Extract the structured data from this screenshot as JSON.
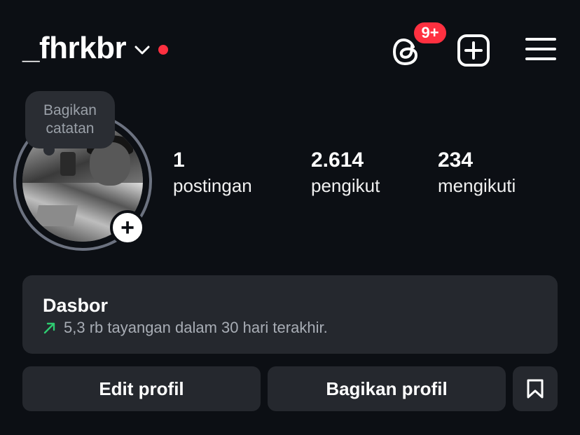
{
  "header": {
    "username": "_fhrkbr",
    "threads_badge": "9+"
  },
  "icons": {
    "threads": "threads-icon",
    "create": "plus-square-icon",
    "menu": "hamburger-menu-icon",
    "chevron": "chevron-down-icon",
    "trend": "arrow-up-right-icon",
    "saved": "bookmark-icon"
  },
  "colors": {
    "background": "#0c0f14",
    "notification": "#ff3040",
    "surface": "#25282e",
    "trend_green": "#2ecc71"
  },
  "profile": {
    "note_line1": "Bagikan",
    "note_line2": "catatan",
    "add_story": "+"
  },
  "stats": [
    {
      "value": "1",
      "label": "postingan"
    },
    {
      "value": "2.614",
      "label": "pengikut"
    },
    {
      "value": "234",
      "label": "mengikuti"
    }
  ],
  "dashboard": {
    "title": "Dasbor",
    "subtitle": "5,3 rb tayangan dalam 30 hari terakhir."
  },
  "actions": {
    "edit_label": "Edit profil",
    "share_label": "Bagikan profil"
  }
}
